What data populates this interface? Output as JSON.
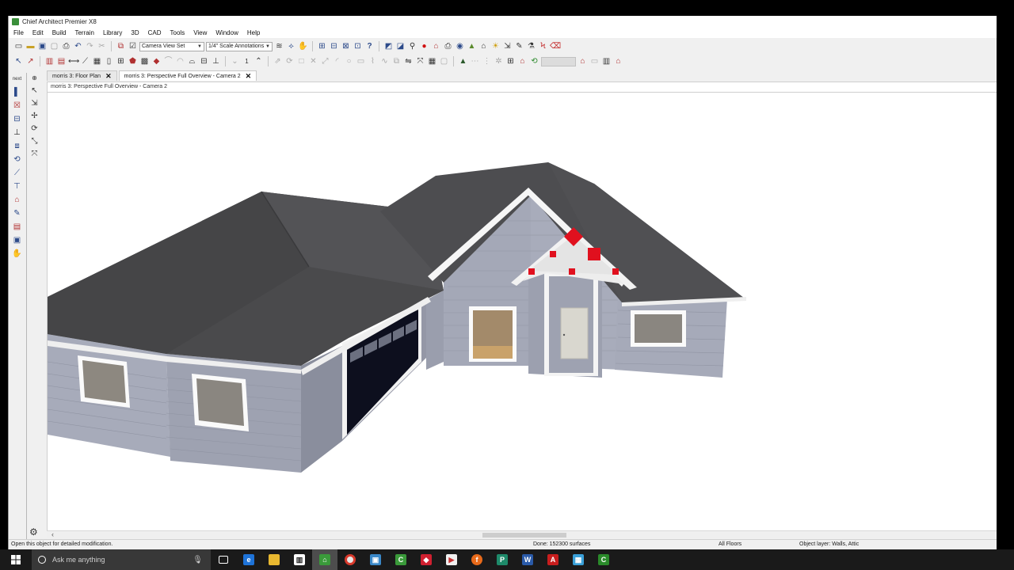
{
  "window": {
    "title": "Chief Architect Premier X8"
  },
  "menu": [
    "File",
    "Edit",
    "Build",
    "Terrain",
    "Library",
    "3D",
    "CAD",
    "Tools",
    "View",
    "Window",
    "Help"
  ],
  "toolbar": {
    "view_set": "Camera View Set",
    "annotation_set": "1/4\" Scale Annotations",
    "floor_number": "1"
  },
  "left_tools": {
    "next_label": "next"
  },
  "tabs": [
    {
      "label": "morris 3: Floor Plan",
      "active": false
    },
    {
      "label": "morris 3: Perspective Full Overview - Camera 2",
      "active": true
    }
  ],
  "view": {
    "title": "morris 3: Perspective Full Overview - Camera 2"
  },
  "status": {
    "hint": "Open this object for detailed modification.",
    "progress": "Done: 152300 surfaces",
    "floors": "All Floors",
    "layer": "Object layer: Walls, Attic"
  },
  "taskbar": {
    "search_placeholder": "Ask me anything",
    "apps": [
      "task-view",
      "edge",
      "file-explorer",
      "store",
      "chief-architect-x8",
      "chrome",
      "remote-desktop",
      "camtasia",
      "app-red",
      "media-player",
      "firefox",
      "publisher",
      "word",
      "acrobat",
      "photo-viewer",
      "chief-architect"
    ]
  },
  "colors": {
    "roof": "#4a4a4c",
    "siding": "#a9adbb",
    "trim": "#f4f4f4",
    "handle": "#e0101e",
    "garage_door": "#0d0f1e"
  }
}
